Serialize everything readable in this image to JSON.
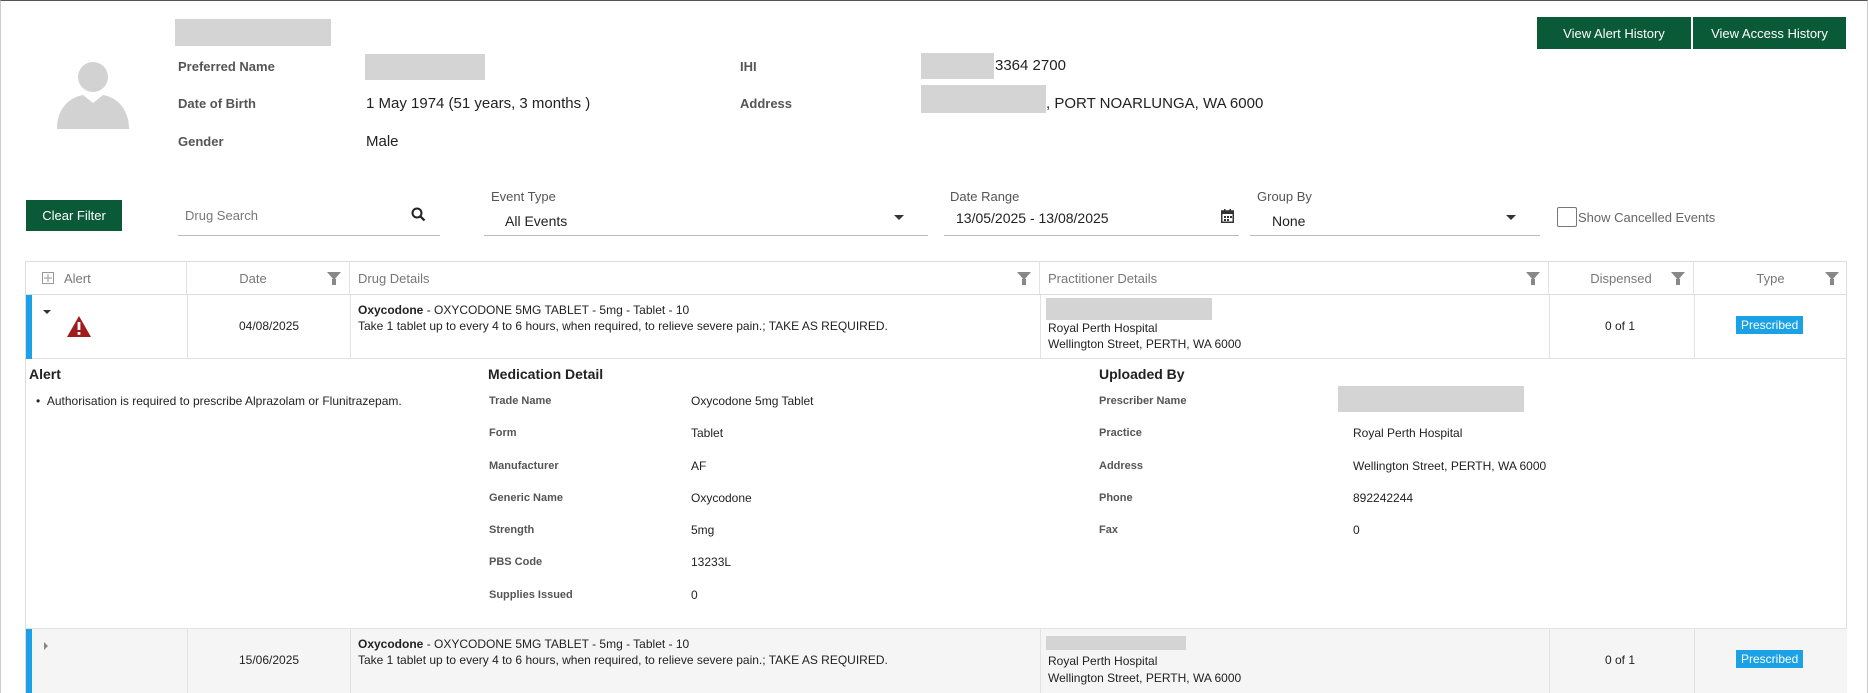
{
  "header": {
    "buttons": {
      "alert_history": "View Alert History",
      "access_history": "View Access History"
    },
    "patient": {
      "preferred_name_label": "Preferred Name",
      "dob_label": "Date of Birth",
      "dob_value": "1 May 1974  (51 years, 3 months )",
      "gender_label": "Gender",
      "gender_value": "Male",
      "ihi_label": "IHI",
      "ihi_value": "3364 2700",
      "address_label": "Address",
      "address_value": ", PORT NOARLUNGA, WA 6000"
    }
  },
  "filters": {
    "clear_filter": "Clear Filter",
    "drug_search_placeholder": "Drug Search",
    "event_type_label": "Event Type",
    "event_type_value": "All Events",
    "date_range_label": "Date Range",
    "date_range_value": "13/05/2025 - 13/08/2025",
    "group_by_label": "Group By",
    "group_by_value": "None",
    "show_cancelled_label": "Show Cancelled Events"
  },
  "grid": {
    "columns": [
      "Alert",
      "Date",
      "Drug Details",
      "Practitioner Details",
      "Dispensed",
      "Type"
    ],
    "rows": [
      {
        "date": "04/08/2025",
        "drug_name": "Oxycodone",
        "drug_desc": " - OXYCODONE 5MG TABLET - 5mg - Tablet - 10",
        "instructions": "Take 1 tablet up to every 4 to 6 hours, when required, to relieve severe pain.; TAKE AS REQUIRED.",
        "practice": "Royal Perth Hospital",
        "practice_address": "Wellington Street, PERTH, WA 6000",
        "dispensed": "0 of 1",
        "type": "Prescribed",
        "expanded": true
      },
      {
        "date": "15/06/2025",
        "drug_name": "Oxycodone",
        "drug_desc": " - OXYCODONE 5MG TABLET - 5mg - Tablet - 10",
        "instructions": "Take 1 tablet up to every 4 to 6 hours, when required, to relieve severe pain.; TAKE AS REQUIRED.",
        "practice": "Royal Perth Hospital",
        "practice_address": "Wellington Street, PERTH, WA 6000",
        "dispensed": "0 of 1",
        "type": "Prescribed",
        "expanded": false
      }
    ],
    "detail": {
      "alert_heading": "Alert",
      "alert_text": "Authorisation is required to prescribe Alprazolam or Flunitrazepam.",
      "medication_heading": "Medication Detail",
      "medication": [
        {
          "label": "Trade Name",
          "value": "Oxycodone 5mg Tablet"
        },
        {
          "label": "Form",
          "value": "Tablet"
        },
        {
          "label": "Manufacturer",
          "value": "AF"
        },
        {
          "label": "Generic Name",
          "value": "Oxycodone"
        },
        {
          "label": "Strength",
          "value": "5mg"
        },
        {
          "label": "PBS Code",
          "value": "13233L"
        },
        {
          "label": "Supplies Issued",
          "value": "0"
        }
      ],
      "uploaded_heading": "Uploaded By",
      "uploaded": [
        {
          "label": "Prescriber Name",
          "value": ""
        },
        {
          "label": "Practice",
          "value": "Royal Perth Hospital"
        },
        {
          "label": "Address",
          "value": "Wellington Street, PERTH, WA 6000"
        },
        {
          "label": "Phone",
          "value": "892242244"
        },
        {
          "label": "Fax",
          "value": "0"
        }
      ]
    }
  },
  "colors": {
    "brand_green": "#0b5a37",
    "accent_blue": "#1aa1e6",
    "alert_red": "#a01c1c"
  },
  "icons": [
    "avatar-icon",
    "search-icon",
    "calendar-icon",
    "warning-icon",
    "filter-icon",
    "expand-all-icon"
  ]
}
